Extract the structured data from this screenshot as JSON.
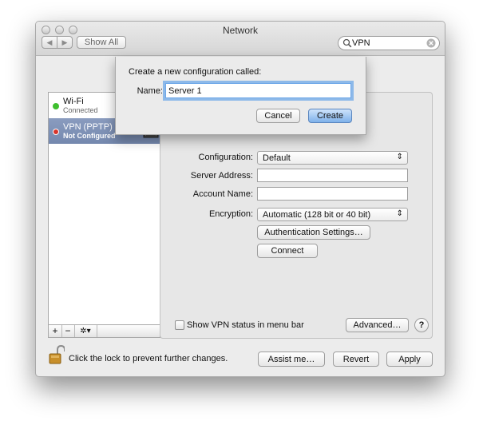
{
  "window": {
    "title": "Network"
  },
  "toolbar": {
    "show_all_label": "Show All",
    "back_arrow": "◀",
    "forward_arrow": "▶"
  },
  "search": {
    "value": "VPN",
    "icon": "magnifier-icon",
    "clear_icon": "clear-icon"
  },
  "sheet": {
    "prompt": "Create a new configuration called:",
    "name_label": "Name:",
    "name_value": "Server 1",
    "cancel_label": "Cancel",
    "create_label": "Create"
  },
  "sidebar": {
    "items": [
      {
        "title": "Wi-Fi",
        "subtitle": "Connected",
        "status_color": "#3fbf2f",
        "icon": "wifi-icon",
        "selected": false
      },
      {
        "title": "VPN (PPTP)",
        "subtitle": "Not Configured",
        "status_color": "#d8342b",
        "icon": "vpn-icon",
        "selected": true
      }
    ],
    "add_label": "+",
    "remove_label": "−",
    "gear_label": "✲▾"
  },
  "detail": {
    "configuration": {
      "label": "Configuration:",
      "value": "Default",
      "arrows": "⇕"
    },
    "server_address": {
      "label": "Server Address:",
      "value": ""
    },
    "account_name": {
      "label": "Account Name:",
      "value": ""
    },
    "encryption": {
      "label": "Encryption:",
      "value": "Automatic (128 bit or 40 bit)",
      "arrows": "⇕"
    },
    "auth_button": "Authentication Settings…",
    "connect_button": "Connect",
    "show_status_label": "Show VPN status in menu bar",
    "show_status_checked": false,
    "advanced_button": "Advanced…",
    "help_label": "?"
  },
  "footer": {
    "lock_text": "Click the lock to prevent further changes.",
    "assist_button": "Assist me…",
    "revert_button": "Revert",
    "apply_button": "Apply"
  },
  "colors": {
    "selection": "#8a9cbf",
    "default_button": "#8dbbf0",
    "focus_ring": "#6ea8e8"
  }
}
